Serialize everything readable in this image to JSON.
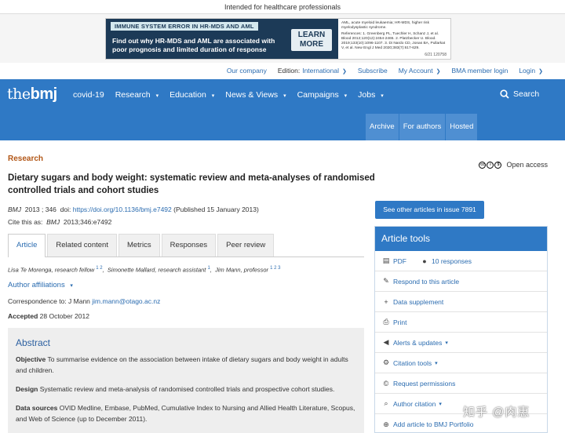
{
  "top_notice": "Intended for healthcare professionals",
  "ad": {
    "headline": "IMMUNE SYSTEM ERROR IN HR-MDS AND AML",
    "body": "Find out why HR-MDS and AML are associated with poor prognosis and limited duration of response",
    "button": "LEARN MORE",
    "fineprint_1": "AML, acute myeloid leukaemia; HR-MDS, higher risk myelodysplastic syndrome.",
    "fineprint_2": "References: 1. Greenberg PL, Tuechler H, Schanz J, et al. Blood 2012;120(12):2454-2465. 2. Platzbecker U. Blood. 2019;133(10):1096-1107. 3. Di Nardo CD, Jonas BA, Pullarkat V, et al. New Engl J Med 2020;383(7):617-629.",
    "code": "6/21    120758"
  },
  "utility_nav": {
    "our_company": "Our company",
    "edition_label": "Edition:",
    "edition_value": "International",
    "subscribe": "Subscribe",
    "my_account": "My Account",
    "bma_login": "BMA member login",
    "login": "Login"
  },
  "logo": {
    "the": "the",
    "bmj": "bmj"
  },
  "main_nav": [
    "covid-19",
    "Research",
    "Education",
    "News & Views",
    "Campaigns",
    "Jobs"
  ],
  "search_label": "Search",
  "sub_tabs": [
    "Archive",
    "For authors",
    "Hosted"
  ],
  "article": {
    "section": "Research",
    "access": "Open access",
    "title": "Dietary sugars and body weight: systematic review and meta-analyses of randomised controlled trials and cohort studies",
    "journal": "BMJ",
    "volume": "2013 ; 346",
    "doi_label": "doi:",
    "doi": "https://doi.org/10.1136/bmj.e7492",
    "published": "(Published 15 January 2013)",
    "cite_label": "Cite this as:",
    "cite_journal": "BMJ",
    "cite_ref": "2013;346:e7492",
    "tabs": [
      "Article",
      "Related content",
      "Metrics",
      "Responses",
      "Peer review"
    ],
    "author1": "Lisa Te Morenga, research fellow",
    "author1_sup": "1 2",
    "author2": "Simonette Mallard, research assistant",
    "author2_sup": "1",
    "author3": "Jim Mann, professor",
    "author3_sup": "1 2 3",
    "affiliations": "Author affiliations",
    "corr_label": "Correspondence to: J Mann",
    "corr_email": "jim.mann@otago.ac.nz",
    "accepted_label": "Accepted",
    "accepted_date": "28 October 2012"
  },
  "abstract": {
    "heading": "Abstract",
    "objective_label": "Objective",
    "objective": "To summarise evidence on the association between intake of dietary sugars and body weight in adults and children.",
    "design_label": "Design",
    "design": "Systematic review and meta-analysis of randomised controlled trials and prospective cohort studies.",
    "sources_label": "Data sources",
    "sources": "OVID Medline, Embase, PubMed, Cumulative Index to Nursing and Allied Health Literature, Scopus, and Web of Science (up to December 2011)."
  },
  "issue_button": "See other articles in issue 7891",
  "article_tools": {
    "heading": "Article tools",
    "pdf": "PDF",
    "responses": "10 responses",
    "respond": "Respond to this article",
    "data_supplement": "Data supplement",
    "print": "Print",
    "alerts": "Alerts & updates",
    "citation_tools": "Citation tools",
    "permissions": "Request permissions",
    "author_citation": "Author citation",
    "portfolio": "Add article to BMJ Portfolio"
  },
  "watermark": "知乎 @肉恵"
}
